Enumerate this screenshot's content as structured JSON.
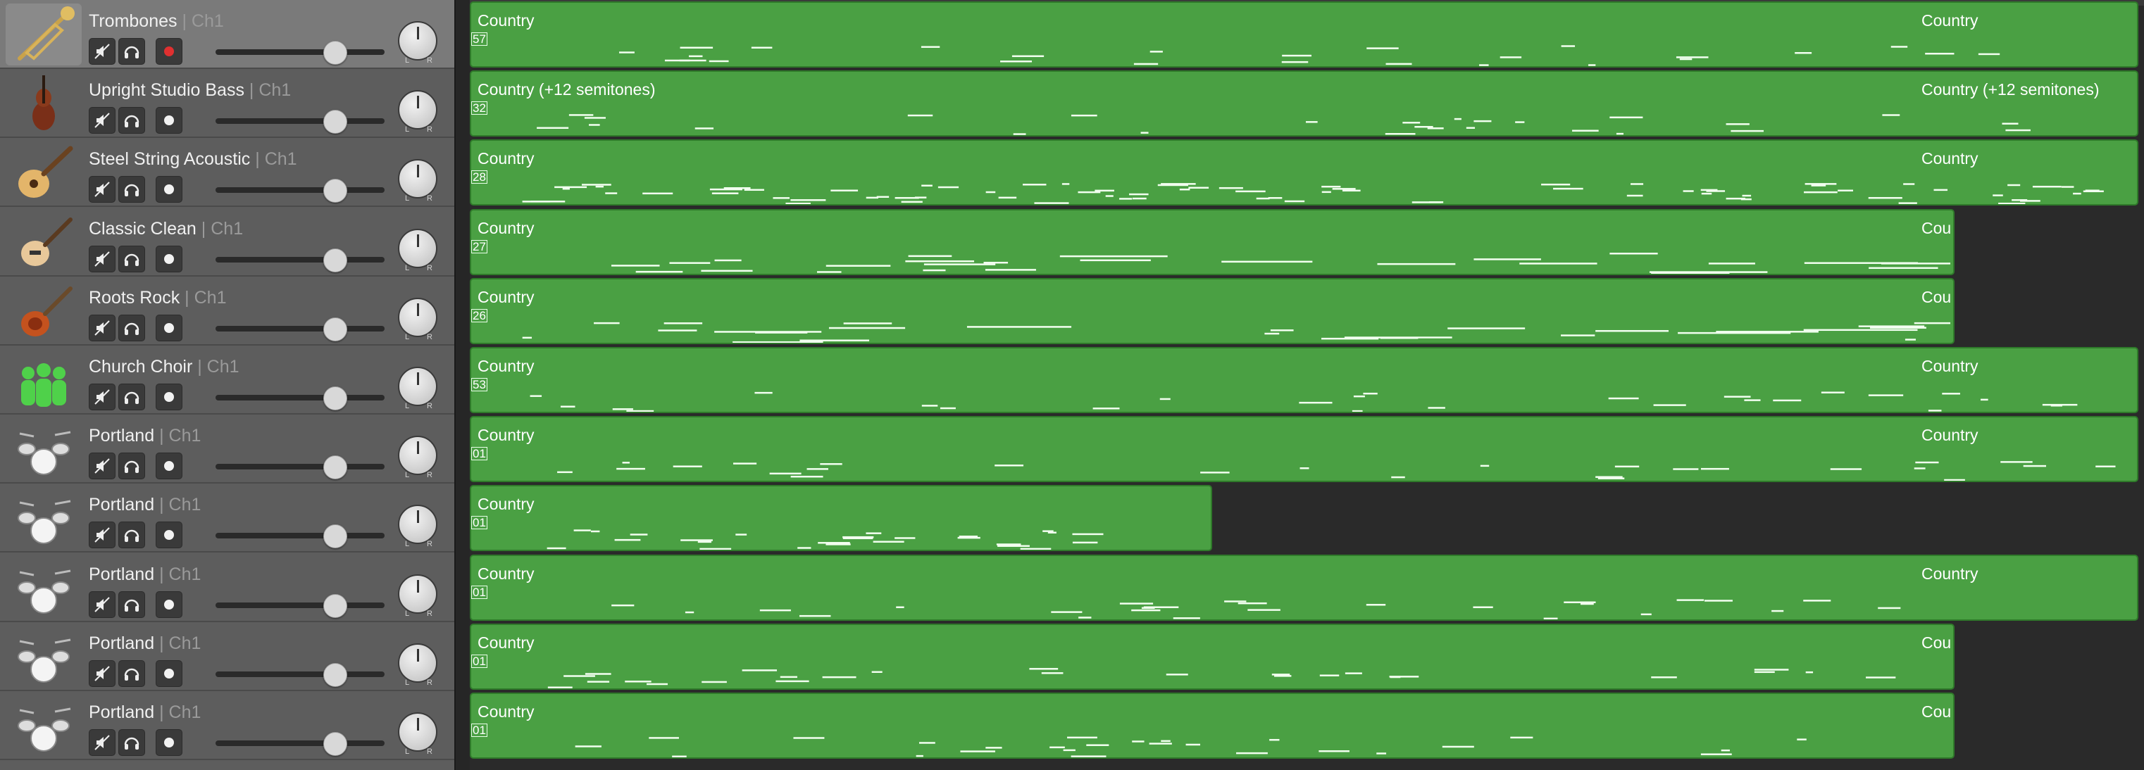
{
  "tracks": [
    {
      "name": "Trombones",
      "channel": "| Ch1",
      "icon": "trombone-icon",
      "selected": true,
      "armed": true,
      "region": {
        "label": "Country",
        "label2": "Country",
        "number": "57",
        "end": "full"
      }
    },
    {
      "name": "Upright Studio Bass",
      "channel": "| Ch1",
      "icon": "upright-bass-icon",
      "selected": false,
      "armed": false,
      "region": {
        "label": "Country (+12 semitones)",
        "label2": "Country (+12 semitones)",
        "number": "32",
        "end": "full"
      }
    },
    {
      "name": "Steel String Acoustic",
      "channel": "| Ch1",
      "icon": "acoustic-guitar-icon",
      "selected": false,
      "armed": false,
      "region": {
        "label": "Country",
        "label2": "Country",
        "number": "28",
        "end": "full"
      }
    },
    {
      "name": "Classic Clean",
      "channel": "| Ch1",
      "icon": "electric-guitar-icon",
      "selected": false,
      "armed": false,
      "region": {
        "label": "Country",
        "label2": "Cou",
        "number": "27",
        "end": "short"
      }
    },
    {
      "name": "Roots Rock",
      "channel": "| Ch1",
      "icon": "rock-guitar-icon",
      "selected": false,
      "armed": false,
      "region": {
        "label": "Country",
        "label2": "Cou",
        "number": "26",
        "end": "short"
      }
    },
    {
      "name": "Church Choir",
      "channel": "| Ch1",
      "icon": "choir-icon",
      "selected": false,
      "armed": false,
      "region": {
        "label": "Country",
        "label2": "Country",
        "number": "53",
        "end": "full"
      }
    },
    {
      "name": "Portland",
      "channel": "| Ch1",
      "icon": "drum-kit-icon",
      "selected": false,
      "armed": false,
      "region": {
        "label": "Country",
        "label2": "Country",
        "number": "01",
        "end": "full"
      }
    },
    {
      "name": "Portland",
      "channel": "| Ch1",
      "icon": "drum-kit-icon",
      "selected": false,
      "armed": false,
      "region": {
        "label": "Country",
        "label2": "",
        "number": "01",
        "end": "half"
      }
    },
    {
      "name": "Portland",
      "channel": "| Ch1",
      "icon": "drum-kit-icon",
      "selected": false,
      "armed": false,
      "region": {
        "label": "Country",
        "label2": "Country",
        "number": "01",
        "end": "full"
      }
    },
    {
      "name": "Portland",
      "channel": "| Ch1",
      "icon": "drum-kit-icon",
      "selected": false,
      "armed": false,
      "region": {
        "label": "Country",
        "label2": "Cou",
        "number": "01",
        "end": "short"
      }
    },
    {
      "name": "Portland",
      "channel": "| Ch1",
      "icon": "drum-kit-icon",
      "selected": false,
      "armed": false,
      "region": {
        "label": "Country",
        "label2": "Cou",
        "number": "01",
        "end": "short"
      }
    }
  ],
  "pan": {
    "left": "L",
    "right": "R"
  },
  "colors": {
    "region": "#4aa043",
    "record": "#e03030",
    "header": "#5d5d5d",
    "selected_header": "#7a7a7a"
  }
}
